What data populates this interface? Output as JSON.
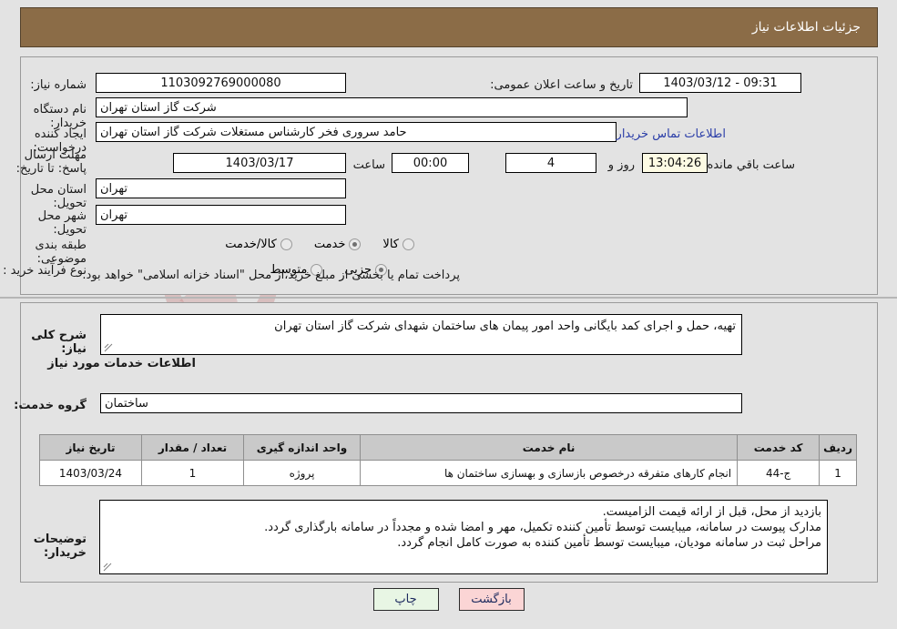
{
  "header": {
    "title": "جزئیات اطلاعات نیاز",
    "bg_color": "#8b6c47"
  },
  "fields": {
    "need_number_label": "شماره نیاز:",
    "need_number_value": "1103092769000080",
    "announce_label": "تاریخ و ساعت اعلان عمومی:",
    "announce_value": "09:31 - 1403/03/12",
    "buyer_org_label": "نام دستگاه خریدار:",
    "buyer_org_value": "شرکت گاز استان تهران",
    "creator_label": "ایجاد کننده درخواست:",
    "creator_value": "حامد سروری فخر کارشناس مستغلات شرکت گاز استان تهران",
    "buyer_contact_link": "اطلاعات تماس خریدار",
    "deadline_label": "مهلت ارسال پاسخ: تا تاریخ:",
    "deadline_date": "1403/03/17",
    "deadline_hour_label": "ساعت",
    "deadline_time": "00:00",
    "days_left": "4",
    "days_word": "روز و",
    "countdown": "13:04:26",
    "countdown_suffix": "ساعت باقي مانده",
    "province_label": "استان محل تحویل:",
    "province_value": "تهران",
    "city_label": "شهر محل تحویل:",
    "city_value": "تهران",
    "category_label": "طبقه بندی موضوعی:",
    "process_label": "نوع فرآیند خرید :",
    "payment_note": "پرداخت تمام یا بخشی از مبلغ خرید،از محل \"اسناد خزانه اسلامی\" خواهد بود."
  },
  "category_options": [
    {
      "label": "کالا",
      "selected": false
    },
    {
      "label": "خدمت",
      "selected": true
    },
    {
      "label": "کالا/خدمت",
      "selected": false
    }
  ],
  "process_options": [
    {
      "label": "جزیی",
      "selected": true
    },
    {
      "label": "متوسط",
      "selected": false
    }
  ],
  "description": {
    "label": "شرح کلی نیاز:",
    "value": "تهیه، حمل و اجرای کمد بایگانی واحد امور پیمان های ساختمان شهدای شرکت گاز استان تهران"
  },
  "services_section": {
    "heading": "اطلاعات خدمات مورد نیاز",
    "group_label": "گروه خدمت:",
    "group_value": "ساختمان"
  },
  "table": {
    "columns": [
      "ردیف",
      "کد خدمت",
      "نام خدمت",
      "واحد اندازه گیری",
      "تعداد / مقدار",
      "تاریخ نیاز"
    ],
    "rows": [
      {
        "row": "1",
        "code": "ج-44",
        "name": "انجام کارهای متفرقه درخصوص بازسازی و بهسازی ساختمان ها",
        "unit": "پروژه",
        "qty": "1",
        "date": "1403/03/24"
      }
    ]
  },
  "buyer_notes": {
    "label": "توضیحات خریدار:",
    "lines": [
      "بازدید از محل، قبل از ارائه قیمت الزامیست.",
      "مدارک پیوست در سامانه، میبایست توسط تأمین کننده تکمیل، مهر و امضا شده و مجدداً در سامانه بارگذاری گردد.",
      "مراحل ثبت در سامانه مودیان، میبایست توسط تأمین کننده به صورت کامل انجام گردد."
    ]
  },
  "buttons": {
    "print": "چاپ",
    "back": "بازگشت"
  },
  "watermark": {
    "text": "AriaTender.net"
  }
}
